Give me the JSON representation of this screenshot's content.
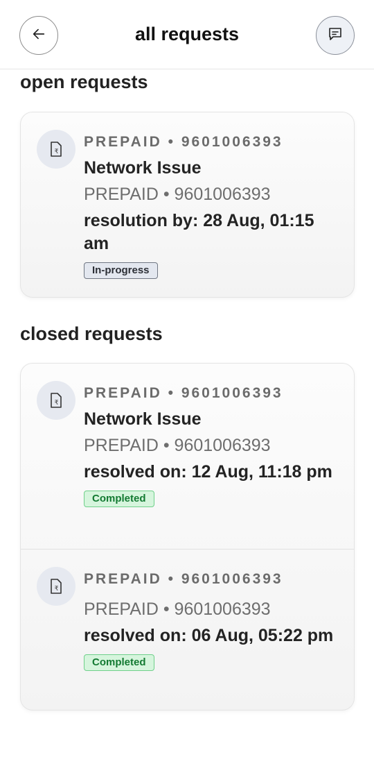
{
  "header": {
    "title": "all requests",
    "back_icon": "arrow-left-icon",
    "chat_icon": "chat-bubble-icon"
  },
  "open_section": {
    "title": "open requests",
    "items": [
      {
        "icon": "rupee-document-icon",
        "meta_top": "PREPAID • 9601006393",
        "title": "Network Issue",
        "meta_sub": "PREPAID • 9601006393",
        "resolution": "resolution by: 28 Aug, 01:15 am",
        "status": "In-progress"
      }
    ]
  },
  "closed_section": {
    "title": "closed requests",
    "items": [
      {
        "icon": "rupee-document-icon",
        "meta_top": "PREPAID • 9601006393",
        "title": "Network Issue",
        "meta_sub": "PREPAID • 9601006393",
        "resolution": "resolved on: 12 Aug, 11:18 pm",
        "status": "Completed"
      },
      {
        "icon": "rupee-document-icon",
        "meta_top": "PREPAID • 9601006393",
        "meta_sub": "PREPAID • 9601006393",
        "resolution": "resolved on: 06 Aug, 05:22 pm",
        "status": "Completed"
      }
    ]
  },
  "colors": {
    "in_progress_badge": "#e3e7ef",
    "completed_badge": "#d6f5dd",
    "completed_text": "#137a32"
  }
}
